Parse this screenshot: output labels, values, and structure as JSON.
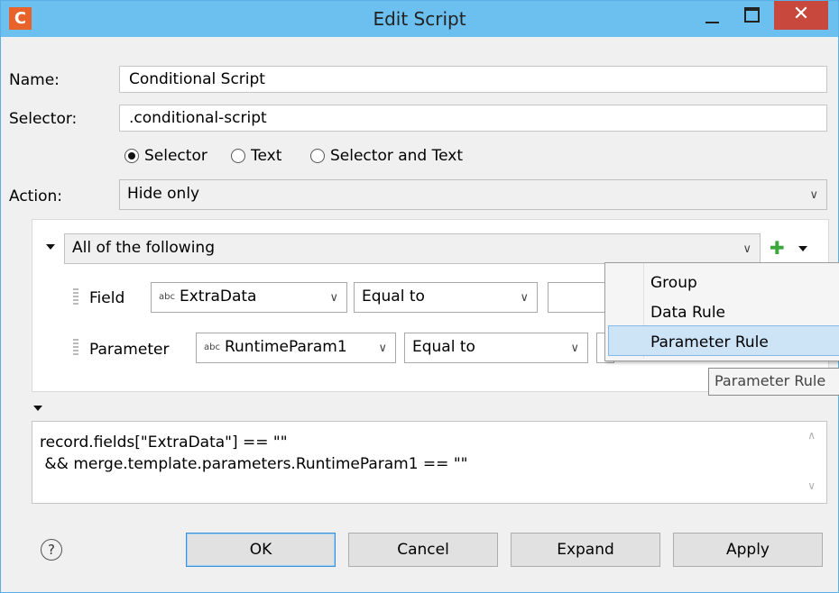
{
  "window": {
    "title": "Edit Script",
    "app_icon": "C",
    "close_glyph": "✕"
  },
  "form": {
    "name_label": "Name:",
    "name_value": "Conditional Script",
    "selector_label": "Selector:",
    "selector_value": ".conditional-script",
    "radios": [
      {
        "label": "Selector",
        "checked": true
      },
      {
        "label": "Text",
        "checked": false
      },
      {
        "label": "Selector and Text",
        "checked": false
      }
    ],
    "action_label": "Action:",
    "action_value": "Hide only"
  },
  "rules": {
    "group_condition": "All of the following",
    "rows": [
      {
        "type": "Field",
        "value": "ExtraData",
        "operator": "Equal to",
        "type_badge": "abc"
      },
      {
        "type": "Parameter",
        "value": "RuntimeParam1",
        "operator": "Equal to",
        "type_badge": "abc"
      }
    ],
    "add_glyph": "✚"
  },
  "add_menu": {
    "items": [
      "Group",
      "Data Rule",
      "Parameter Rule"
    ],
    "highlighted": "Parameter Rule",
    "tooltip": "Parameter Rule"
  },
  "code": {
    "lines": [
      "record.fields[\"ExtraData\"] == \"\"",
      " && merge.template.parameters.RuntimeParam1 == \"\""
    ]
  },
  "buttons": {
    "help": "?",
    "ok": "OK",
    "cancel": "Cancel",
    "expand": "Expand",
    "apply": "Apply"
  },
  "colors": {
    "titlebar": "#6cc0f0",
    "close": "#c9483d",
    "app_icon": "#e8632a",
    "add_icon": "#3aa83a",
    "menu_highlight": "#cde4f7"
  },
  "icons": [
    "app-logo-icon",
    "minimize-icon",
    "maximize-icon",
    "close-icon",
    "chevron-down-icon",
    "add-icon",
    "drag-handle-icon",
    "help-icon",
    "scroll-up-icon",
    "scroll-down-icon"
  ]
}
